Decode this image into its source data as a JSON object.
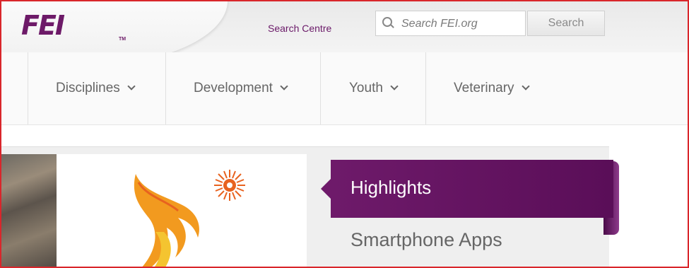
{
  "header": {
    "logo": "FEI",
    "logo_tm": "TM",
    "search_centre": "Search Centre",
    "search_placeholder": "Search FEI.org",
    "search_button": "Search"
  },
  "nav": {
    "items": [
      {
        "label": "Disciplines"
      },
      {
        "label": "Development"
      },
      {
        "label": "Youth"
      },
      {
        "label": "Veterinary"
      }
    ]
  },
  "sidebar": {
    "highlight": "Highlights",
    "items": [
      {
        "label": "Smartphone Apps"
      }
    ]
  },
  "colors": {
    "brand_purple": "#6d1a68",
    "frame_red": "#d9262b",
    "flame_orange": "#e8621f",
    "flame_yellow": "#f4b400"
  }
}
